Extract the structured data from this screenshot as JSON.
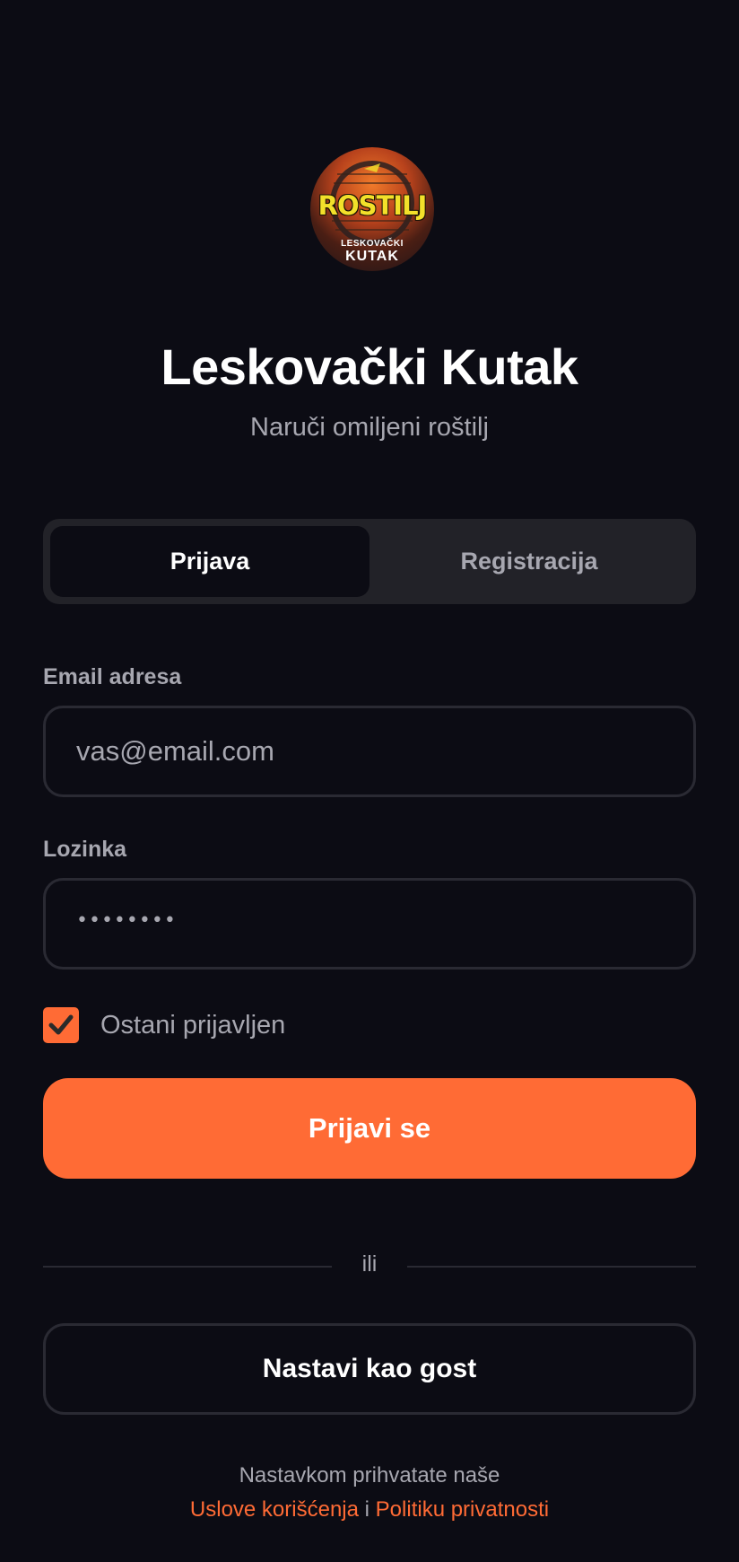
{
  "logo": {
    "main_text": "ROSTILJ",
    "sub_text_1": "LESKOVAČKI",
    "sub_text_2": "KUTAK"
  },
  "header": {
    "title": "Leskovački Kutak",
    "subtitle": "Naruči omiljeni roštilj"
  },
  "tabs": {
    "active": "Prijava",
    "items": [
      {
        "label": "Prijava"
      },
      {
        "label": "Registracija"
      }
    ]
  },
  "form": {
    "email_label": "Email adresa",
    "email_placeholder": "vas@email.com",
    "email_value": "",
    "password_label": "Lozinka",
    "password_display": "••••••••",
    "remember_label": "Ostani prijavljen",
    "remember_checked": true,
    "submit_label": "Prijavi se"
  },
  "divider": {
    "text": "ili"
  },
  "guest": {
    "label": "Nastavi kao gost"
  },
  "footer": {
    "text": "Nastavkom prihvatate naše",
    "terms_link": "Uslove korišćenja",
    "conjunction": "i",
    "privacy_link": "Politiku privatnosti"
  },
  "colors": {
    "background": "#0c0c14",
    "accent": "#ff6b35",
    "muted_text": "#a7a7b0",
    "surface": "#222228",
    "border": "#2a2a33"
  }
}
